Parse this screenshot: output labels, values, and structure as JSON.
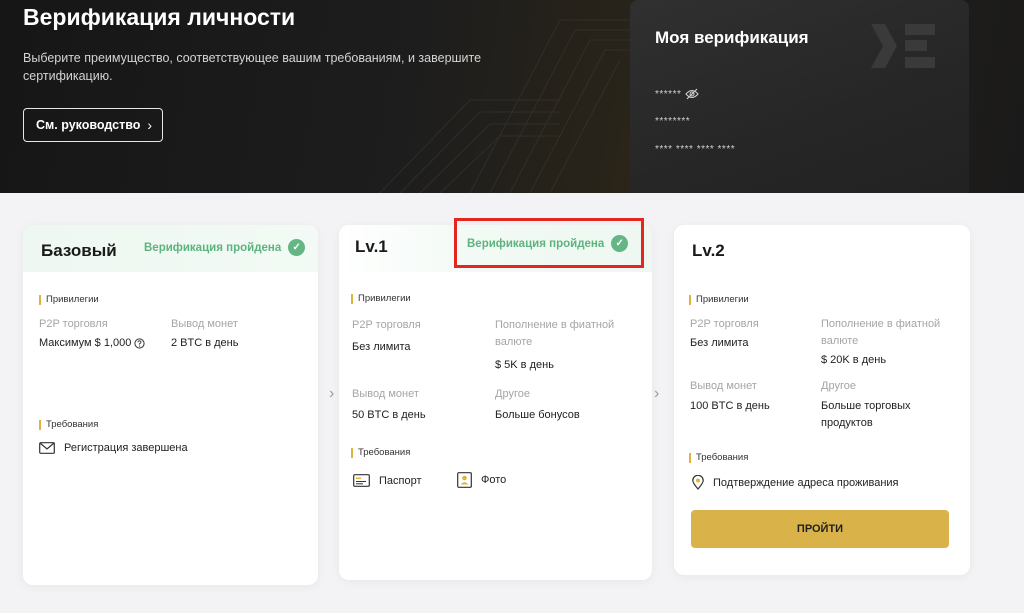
{
  "hero": {
    "title": "Верификация личности",
    "description": "Выберите преимущество, соответствующее вашим требованиям, и завершите сертификацию.",
    "guide_button": "См. руководство",
    "guide_chevron": "›"
  },
  "my_verification": {
    "title": "Моя верификация",
    "row1": "******",
    "row2": "********",
    "row3": "**** **** **** ****"
  },
  "cards": {
    "basic": {
      "name": "Базовый",
      "status": "Верификация пройдена",
      "privileges_label": "Привилегии",
      "p2p_key": "P2P торговля",
      "p2p_value": "Максимум $ 1,000",
      "withdraw_key": "Вывод монет",
      "withdraw_value": "2 BTC в день",
      "requirements_label": "Требования",
      "requirement": "Регистрация завершена"
    },
    "lv1": {
      "name": "Lv.1",
      "status": "Верификация пройдена",
      "privileges_label": "Привилегии",
      "p2p_key": "P2P торговля",
      "p2p_value": "Без лимита",
      "fiat_key": "Пополнение в фиатной валюте",
      "fiat_value": "$ 5K в день",
      "withdraw_key": "Вывод монет",
      "withdraw_value": "50 BTC в день",
      "other_key": "Другое",
      "other_value": "Больше бонусов",
      "requirements_label": "Требования",
      "req_passport": "Паспорт",
      "req_photo": "Фото"
    },
    "lv2": {
      "name": "Lv.2",
      "privileges_label": "Привилегии",
      "p2p_key": "P2P торговля",
      "p2p_value": "Без лимита",
      "fiat_key": "Пополнение в фиатной валюте",
      "fiat_value": "$ 20K в день",
      "withdraw_key": "Вывод монет",
      "withdraw_value": "100 BTC в день",
      "other_key": "Другое",
      "other_value": "Больше торговых продуктов",
      "requirements_label": "Требования",
      "req_address": "Подтверждение адреса проживания",
      "go_button": "ПРОЙТИ"
    }
  },
  "colors": {
    "accent_gold": "#d9b34a",
    "success_green": "#64b785",
    "highlight_red": "#e5261f"
  },
  "icons": [
    "chevron-right-icon",
    "eye-off-icon",
    "check-circle-icon",
    "mail-icon",
    "id-card-icon",
    "photo-icon",
    "location-pin-icon",
    "help-circle-icon"
  ]
}
